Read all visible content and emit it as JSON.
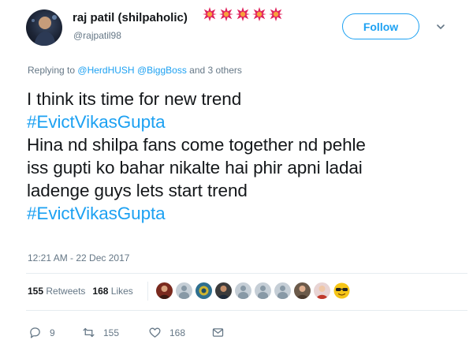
{
  "user": {
    "display_name": "raj patil (shilpaholic)",
    "handle": "@rajpatil98",
    "name_emoji": "star-burst-emoji",
    "name_emoji_count": 5
  },
  "follow_label": "Follow",
  "replying": {
    "prefix": "Replying to",
    "mentions": [
      "@HerdHUSH",
      "@BiggBoss"
    ],
    "suffix": "and 3 others"
  },
  "tweet": {
    "lines": [
      "I think its time for new trend",
      "#EvictVikasGupta",
      "Hina nd shilpa fans come together nd pehle",
      "iss gupti ko bahar nikalte hai phir apni ladai",
      "ladenge guys lets start trend",
      "#EvictVikasGupta"
    ]
  },
  "timestamp": "12:21 AM - 22 Dec 2017",
  "stats": {
    "retweets_count": "155",
    "retweets_label": "Retweets",
    "likes_count": "168",
    "likes_label": "Likes"
  },
  "likers": [
    {
      "icon": "user-photo-avatar",
      "color": "#7a2a1e"
    },
    {
      "icon": "default-avatar",
      "color": "#c5ced6"
    },
    {
      "icon": "user-photo-avatar",
      "color": "#2e6f8f"
    },
    {
      "icon": "user-photo-avatar",
      "color": "#3b3b3b"
    },
    {
      "icon": "default-avatar",
      "color": "#c5ced6"
    },
    {
      "icon": "default-avatar",
      "color": "#c5ced6"
    },
    {
      "icon": "default-avatar",
      "color": "#c5ced6"
    },
    {
      "icon": "user-photo-avatar",
      "color": "#6b5a4a"
    },
    {
      "icon": "user-photo-avatar",
      "color": "#e8d4d4"
    },
    {
      "icon": "sunglasses-emoji-avatar",
      "color": "#f5c518"
    }
  ],
  "actions": {
    "reply_count": "9",
    "retweet_count": "155",
    "like_count": "168"
  },
  "colors": {
    "accent": "#1da1f2",
    "muted": "#657786",
    "text": "#14171a",
    "star": "#e0245e"
  }
}
